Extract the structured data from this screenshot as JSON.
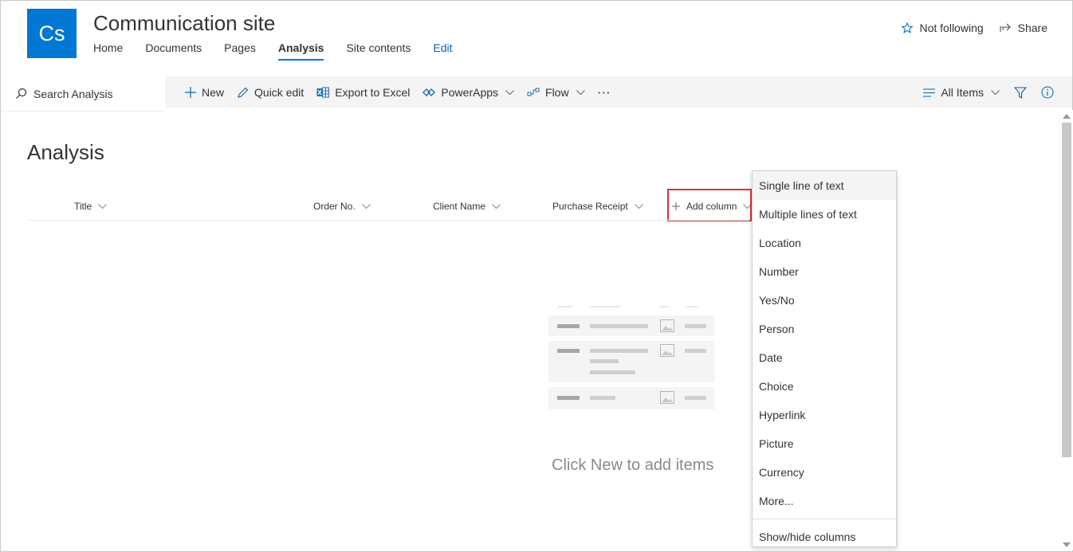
{
  "header": {
    "logo_text": "Cs",
    "site_title": "Communication site",
    "nav": [
      {
        "label": "Home"
      },
      {
        "label": "Documents"
      },
      {
        "label": "Pages"
      },
      {
        "label": "Analysis"
      },
      {
        "label": "Site contents"
      },
      {
        "label": "Edit"
      }
    ],
    "not_following": "Not following",
    "share": "Share"
  },
  "toolbar": {
    "search_placeholder": "Search Analysis",
    "new": "New",
    "quick_edit": "Quick edit",
    "export": "Export to Excel",
    "powerapps": "PowerApps",
    "flow": "Flow",
    "more": "···",
    "view": "All Items"
  },
  "list": {
    "title": "Analysis",
    "columns": [
      "Title",
      "Order No.",
      "Client Name",
      "Purchase Receipt"
    ],
    "add_column": "Add column",
    "empty_message": "Click New to add items"
  },
  "menu": {
    "items": [
      "Single line of text",
      "Multiple lines of text",
      "Location",
      "Number",
      "Yes/No",
      "Person",
      "Date",
      "Choice",
      "Hyperlink",
      "Picture",
      "Currency",
      "More..."
    ],
    "footer": "Show/hide columns"
  },
  "colors": {
    "accent": "#0078d4",
    "highlight": "#d13438"
  },
  "icons": [
    "star-icon",
    "share-icon",
    "search-icon",
    "plus-icon",
    "pencil-icon",
    "excel-icon",
    "powerapps-icon",
    "flow-icon",
    "more-icon",
    "list-icon",
    "filter-icon",
    "info-icon",
    "chevron-down-icon"
  ]
}
